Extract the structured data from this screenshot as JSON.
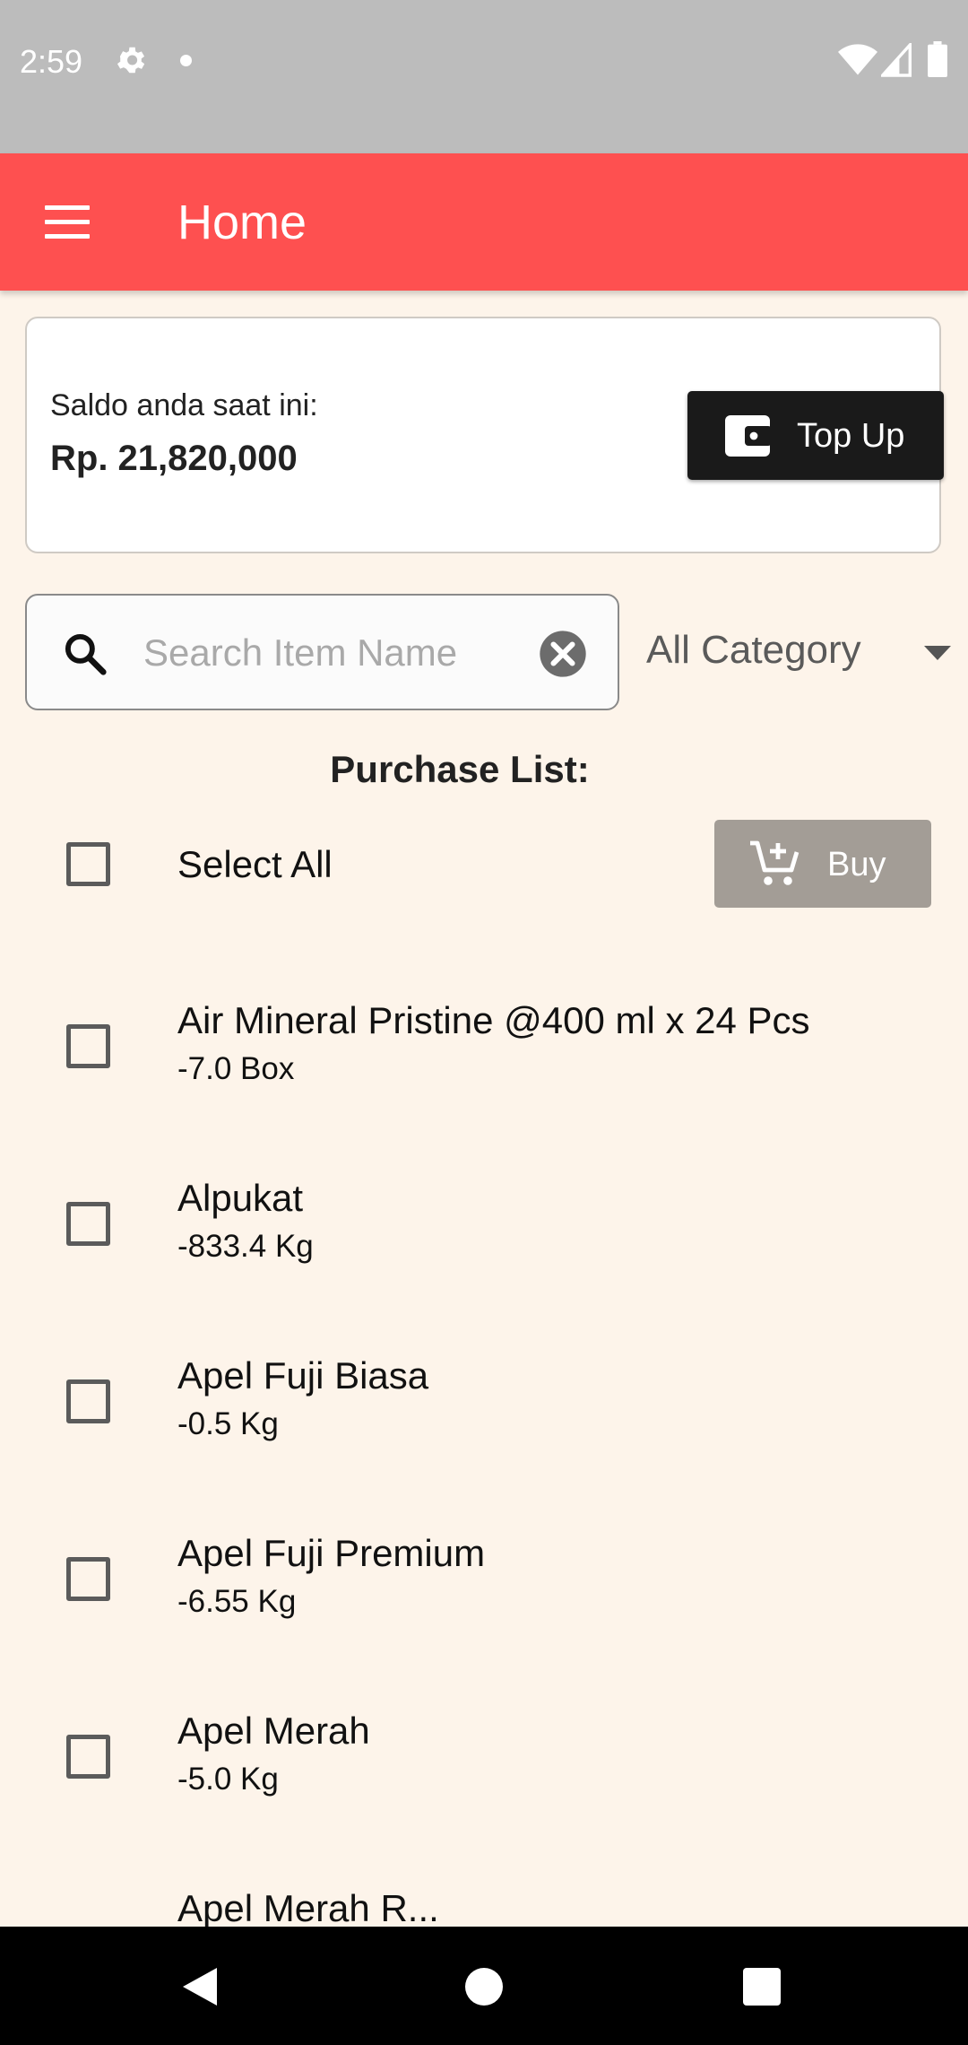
{
  "status_bar": {
    "time": "2:59"
  },
  "app_bar": {
    "title": "Home"
  },
  "balance": {
    "label": "Saldo anda saat ini:",
    "value": "Rp. 21,820,000",
    "topup_label": "Top Up"
  },
  "search": {
    "placeholder": "Search Item Name",
    "value": ""
  },
  "category": {
    "selected": "All Category"
  },
  "purchase": {
    "title": "Purchase List:",
    "select_all_label": "Select All",
    "buy_label": "Buy",
    "items": [
      {
        "name": "Air Mineral Pristine @400 ml x 24 Pcs",
        "qty": "-7.0  Box"
      },
      {
        "name": "Alpukat",
        "qty": "-833.4  Kg"
      },
      {
        "name": "Apel Fuji Biasa",
        "qty": "-0.5  Kg"
      },
      {
        "name": "Apel Fuji Premium",
        "qty": "-6.55  Kg"
      },
      {
        "name": "Apel Merah",
        "qty": "-5.0  Kg"
      },
      {
        "name": "Apel Merah R...",
        "qty": ""
      }
    ]
  },
  "colors": {
    "app_bar": "#fe5050",
    "background": "#fdf4ea",
    "topup_button": "#1a1a1a",
    "buy_button_disabled": "#a39d96"
  }
}
